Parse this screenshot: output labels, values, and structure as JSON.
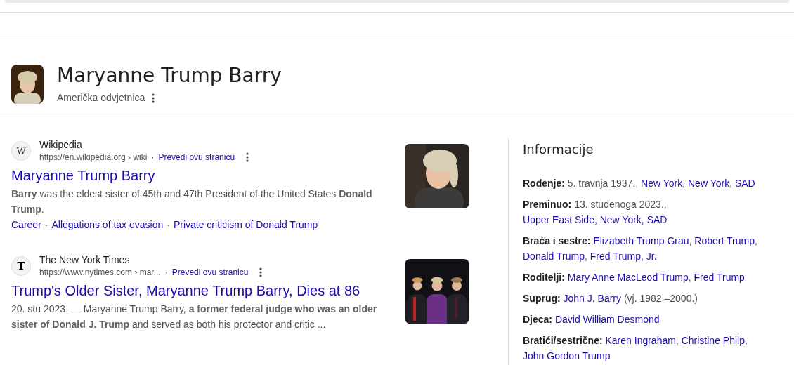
{
  "entity": {
    "title": "Maryanne Trump Barry",
    "subtitle": "Američka odvjetnica"
  },
  "results": [
    {
      "source": "Wikipedia",
      "favicon": "W",
      "url": "https://en.wikipedia.org › wiki",
      "separator": "·",
      "translate": "Prevedi ovu stranicu",
      "title": "Maryanne Trump Barry",
      "snippet": "**Barry** was the eldest sister of 45th and 47th President of the United States **Donald Trump**.",
      "sitelinks": [
        "Career",
        "Allegations of tax evasion",
        "Private criticism of Donald Trump"
      ]
    },
    {
      "source": "The New York Times",
      "favicon": "T",
      "url": "https://www.nytimes.com › mar...",
      "separator": "·",
      "translate": "Prevedi ovu stranicu",
      "title": "Trump's Older Sister, Maryanne Trump Barry, Dies at 86",
      "snippet": "20. stu 2023. — Maryanne Trump Barry, **a former federal judge who was an older sister of Donald J. Trump** and served as both his protector and critic ..."
    }
  ],
  "info": {
    "title": "Informacije",
    "facts": [
      {
        "label": "Rođenje:",
        "parts": [
          {
            "kind": "text",
            "text": "5. travnja 1937., "
          },
          {
            "kind": "link",
            "text": "New York, New York, SAD"
          }
        ]
      },
      {
        "label": "Preminuo:",
        "parts": [
          {
            "kind": "text",
            "text": "13. studenoga 2023., "
          },
          {
            "kind": "link",
            "text": "Upper East Side, New York, SAD"
          }
        ]
      },
      {
        "label": "Braća i sestre:",
        "parts": [
          {
            "kind": "link",
            "text": "Elizabeth Trump Grau"
          },
          {
            "kind": "text",
            "text": ", "
          },
          {
            "kind": "link",
            "text": "Robert Trump"
          },
          {
            "kind": "text",
            "text": ", "
          },
          {
            "kind": "link",
            "text": "Donald Trump"
          },
          {
            "kind": "text",
            "text": ", "
          },
          {
            "kind": "link",
            "text": "Fred Trump, Jr."
          }
        ]
      },
      {
        "label": "Roditelji:",
        "parts": [
          {
            "kind": "link",
            "text": "Mary Anne MacLeod Trump"
          },
          {
            "kind": "text",
            "text": ", "
          },
          {
            "kind": "link",
            "text": "Fred Trump"
          }
        ]
      },
      {
        "label": "Suprug:",
        "parts": [
          {
            "kind": "link",
            "text": "John J. Barry"
          },
          {
            "kind": "text",
            "text": " (vj. 1982.–2000.)"
          }
        ]
      },
      {
        "label": "Djeca:",
        "parts": [
          {
            "kind": "link",
            "text": "David William Desmond"
          }
        ]
      },
      {
        "label": "Bratići/sestrične:",
        "parts": [
          {
            "kind": "link",
            "text": "Karen Ingraham"
          },
          {
            "kind": "text",
            "text": ", "
          },
          {
            "kind": "link",
            "text": "Christine Philp"
          },
          {
            "kind": "text",
            "text": ", "
          },
          {
            "kind": "link",
            "text": "John Gordon Trump"
          }
        ]
      }
    ]
  }
}
